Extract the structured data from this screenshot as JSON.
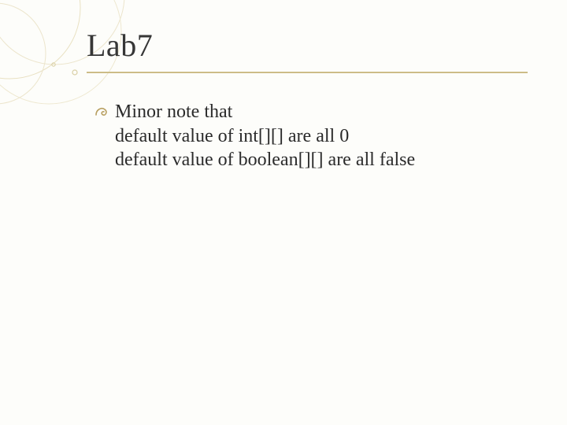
{
  "slide": {
    "title": "Lab7",
    "bullet": {
      "line1": "Minor note that",
      "line2_prefix": "default value of int[][] are all ",
      "line2_zero": "0",
      "line3": "default value of boolean[][] are all false"
    }
  }
}
